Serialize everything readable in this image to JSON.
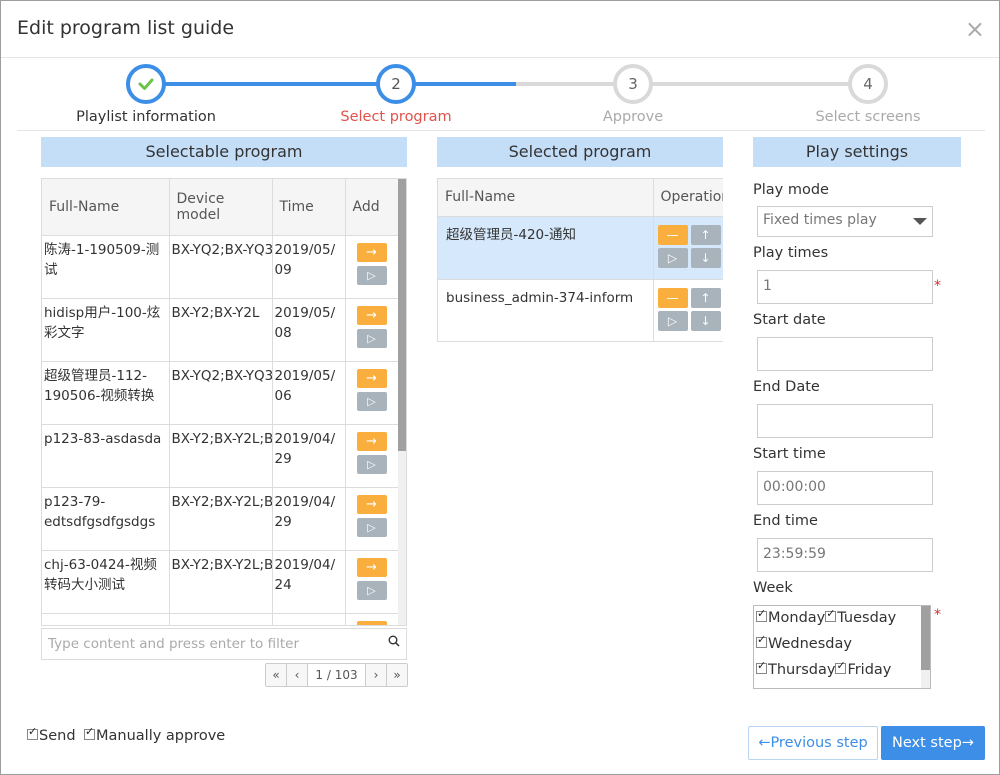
{
  "dialog": {
    "title": "Edit program list guide",
    "close": "×"
  },
  "steps": [
    {
      "num": "",
      "label": "Playlist information",
      "state": "done"
    },
    {
      "num": "2",
      "label": "Select program",
      "state": "active"
    },
    {
      "num": "3",
      "label": "Approve",
      "state": "todo"
    },
    {
      "num": "4",
      "label": "Select screens",
      "state": "todo"
    }
  ],
  "selectable": {
    "title": "Selectable program",
    "columns": [
      "Full-Name",
      "Device model",
      "Time",
      "Add"
    ],
    "rows": [
      {
        "name": "陈涛-1-190509-测试",
        "device": "BX-YQ2;BX-YQ3",
        "time": "2019/05/09"
      },
      {
        "name": "hidisp用户-100-炫彩文字",
        "device": "BX-Y2;BX-Y2L",
        "time": "2019/05/08"
      },
      {
        "name": "超级管理员-112-190506-视频转换",
        "device": "BX-YQ2;BX-YQ3",
        "time": "2019/05/06"
      },
      {
        "name": "p123-83-asdasda",
        "device": "BX-Y2;BX-Y2L;B",
        "time": "2019/04/29"
      },
      {
        "name": "p123-79-edtsdfgsdfgsdgs",
        "device": "BX-Y2;BX-Y2L;B",
        "time": "2019/04/29"
      },
      {
        "name": "chj-63-0424-视频转码大小测试",
        "device": "BX-Y2;BX-Y2L;B",
        "time": "2019/04/24"
      },
      {
        "name": "",
        "device": "",
        "time": ""
      }
    ],
    "filter_placeholder": "Type content and press enter to filter",
    "pager": {
      "first": "«",
      "prev": "‹",
      "page": "1 / 103",
      "next": "›",
      "last": "»"
    }
  },
  "selected": {
    "title": "Selected program",
    "columns": [
      "Full-Name",
      "Operation"
    ],
    "rows": [
      {
        "name": "超级管理员-420-通知",
        "highlight": true
      },
      {
        "name": "business_admin-374-inform",
        "highlight": false
      }
    ]
  },
  "settings": {
    "title": "Play settings",
    "play_mode_label": "Play mode",
    "play_mode_value": "Fixed times play",
    "play_times_label": "Play times",
    "play_times_value": "1",
    "start_date_label": "Start date",
    "start_date_value": "",
    "end_date_label": "End Date",
    "end_date_value": "",
    "start_time_label": "Start time",
    "start_time_value": "00:00:00",
    "end_time_label": "End time",
    "end_time_value": "23:59:59",
    "week_label": "Week",
    "week_rows": [
      [
        "Monday",
        "Tuesday"
      ],
      [
        "Wednesday"
      ],
      [
        "Thursday",
        "Friday"
      ]
    ],
    "required_mark": "*"
  },
  "footer": {
    "send_label": "Send",
    "manual_label": "Manually approve",
    "prev_label": "←Previous step",
    "next_label": "Next step→"
  },
  "icons": {
    "done": "check-icon",
    "add": "arrow-right-icon",
    "play": "play-icon",
    "remove": "minus-icon",
    "up": "arrow-up-icon",
    "down": "arrow-down-icon",
    "search": "search-icon"
  },
  "colors": {
    "accent": "#3d8ee6",
    "active_step": "#e0524b",
    "panel_header": "#c5def8",
    "orange_button": "#f9ae3d",
    "gray_button": "#a9b3bb"
  }
}
